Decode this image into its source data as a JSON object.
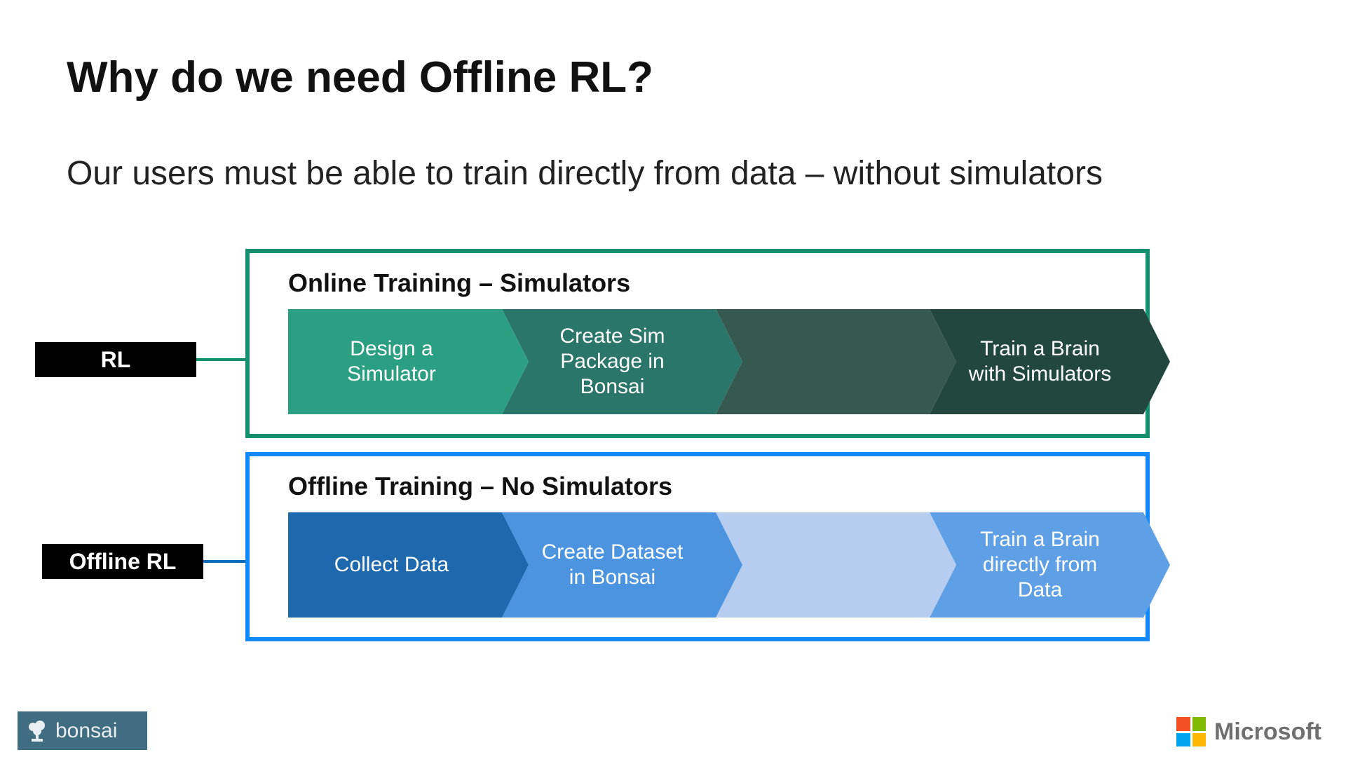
{
  "title": "Why do we need Offline RL?",
  "subtitle": "Our users must be able to train directly from data – without simulators",
  "tags": {
    "rl": "RL",
    "offline_rl": "Offline RL"
  },
  "panel_online": {
    "title": "Online Training – Simulators",
    "steps": [
      "Design a Simulator",
      "Create Sim Package in Bonsai",
      "",
      "Train a Brain with Simulators"
    ]
  },
  "panel_offline": {
    "title": "Offline Training – No Simulators",
    "steps": [
      "Collect Data",
      "Create Dataset in Bonsai",
      "",
      "Train a Brain directly from Data"
    ]
  },
  "footer": {
    "bonsai": "bonsai",
    "microsoft": "Microsoft"
  }
}
